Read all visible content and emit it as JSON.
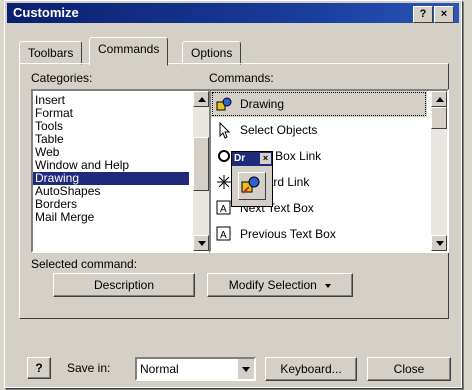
{
  "window": {
    "title": "Customize",
    "help_label": "?",
    "close_label": "×"
  },
  "tabs": [
    "Toolbars",
    "Commands",
    "Options"
  ],
  "categories_label": "Categories:",
  "categories": [
    "Insert",
    "Format",
    "Tools",
    "Table",
    "Web",
    "Window and Help",
    "Drawing",
    "AutoShapes",
    "Borders",
    "Mail Merge"
  ],
  "selected_category": "Drawing",
  "commands_label": "Commands:",
  "commands": [
    {
      "label": "Drawing",
      "icon": "drawing-icon"
    },
    {
      "label": "Select Objects",
      "icon": "pointer-arrow-icon"
    },
    {
      "label": "e Text Box Link",
      "icon": "text-box-link-icon"
    },
    {
      "label": "Forward Link",
      "icon": "forward-link-icon"
    },
    {
      "label": "Next Text Box",
      "icon": "next-text-box-icon"
    },
    {
      "label": "Previous Text Box",
      "icon": "previous-text-box-icon"
    }
  ],
  "drag_floating": {
    "label": "Dr"
  },
  "selected_command_label": "Selected command:",
  "description_button": "Description",
  "modify_selection_button": "Modify Selection",
  "footer": {
    "help_icon_label": "?",
    "save_in_label": "Save in:",
    "save_in_value": "Normal",
    "keyboard_button": "Keyboard...",
    "close_button": "Close"
  },
  "colors": {
    "title_bar": "#0a1f6e",
    "selection": "#1f2a7a",
    "dialog_face": "#d4d0c8"
  }
}
